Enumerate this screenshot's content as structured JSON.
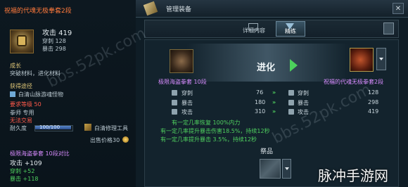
{
  "tooltip": {
    "title": "祝福的代魂无极拳套2段",
    "attack": "攻击 419",
    "pierce": "穿刺 128",
    "crit": "暴击 298",
    "growth_label": "成长",
    "growth_text": "突破材料，进化材料",
    "source_label": "获得途径",
    "source_text": "白清山脉游魂怪物",
    "req_level": "要求等级 50",
    "class_only": "拳师 专用",
    "no_trade": "无法交易",
    "durability_label": "耐久度",
    "durability_value": "100/100",
    "durability_fraction": 1.0,
    "repair_tool": "白清修理工具",
    "sell_price": "出售价格30",
    "compare_title": "极限海盗拳套 10段对比",
    "cmp_attack": "攻击 +109",
    "cmp_pierce": "穿刺 +52",
    "cmp_crit": "暴击 +118"
  },
  "window": {
    "title": "管理装备",
    "close": "✕",
    "tabs": [
      {
        "label": "详细内容"
      },
      {
        "label": "精练"
      }
    ],
    "evolve_label": "进化",
    "left_item_name": "极限海盗拳套 10段",
    "right_item_name": "祝福的代魂无极拳套2段",
    "stats": [
      {
        "name": "穿刺",
        "left": "76",
        "right": "128"
      },
      {
        "name": "暴击",
        "left": "180",
        "right": "298"
      },
      {
        "name": "攻击",
        "left": "310",
        "right": "419"
      }
    ],
    "effects": [
      "有一定几率恢复 100%内力",
      "有一定几率提升暴击伤害18.5%，持续12秒",
      "有一定几率提升暴击 3.5%，持续12秒"
    ],
    "materials_label": "祭品"
  },
  "watermark": "bbs.52pk.com",
  "brand_logo": "脉冲手游网"
}
